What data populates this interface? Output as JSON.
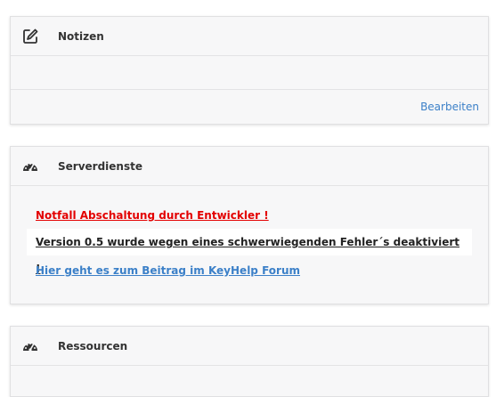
{
  "notes": {
    "title": "Notizen",
    "icon": "edit-icon",
    "edit_label": "Bearbeiten"
  },
  "services": {
    "title": "Serverdienste",
    "icon": "speedometer-icon",
    "emergency_text": "Notfall Abschaltung durch Entwickler !",
    "notice_text": "Version 0.5 wurde wegen eines schwerwiegenden Fehler´s deaktiviert !",
    "forum_link_text": "Hier geht es zum Beitrag im KeyHelp Forum"
  },
  "resources": {
    "title": "Ressourcen",
    "icon": "speedometer-icon"
  },
  "colors": {
    "emergency": "#e30000",
    "link": "#3c80c8",
    "panel_bg": "#f7f7f8"
  }
}
